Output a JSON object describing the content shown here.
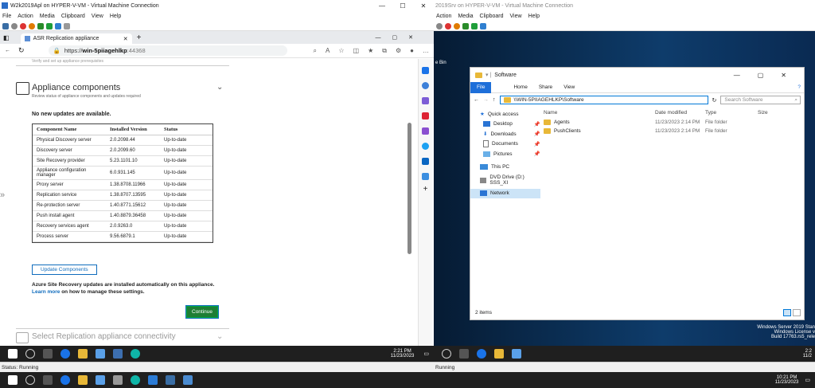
{
  "left_vm": {
    "title": "W2k2019Apl on HYPER-V-VM - Virtual Machine Connection",
    "menu": [
      "File",
      "Action",
      "Media",
      "Clipboard",
      "View",
      "Help"
    ]
  },
  "browser": {
    "tab_title": "ASR Replication appliance",
    "url_prefix": "https://",
    "url_host": "win-5piiagehlkp",
    "url_port": ":44368",
    "note": "Verify and set up appliance prerequisites"
  },
  "appliance": {
    "section_title": "Appliance components",
    "section_sub": "Review status of appliance components and updates required",
    "no_updates": "No new updates are available.",
    "headers": [
      "Component Name",
      "Installed Version",
      "Status"
    ],
    "rows": [
      [
        "Physical Discovery server",
        "2.0.2098.44",
        "Up-to-date"
      ],
      [
        "Discovery server",
        "2.0.2099.60",
        "Up-to-date"
      ],
      [
        "Site Recovery provider",
        "5.23.1101.10",
        "Up-to-date"
      ],
      [
        "Appliance configuration manager",
        "6.0.931.145",
        "Up-to-date"
      ],
      [
        "Proxy server",
        "1.38.8708.11966",
        "Up-to-date"
      ],
      [
        "Replication service",
        "1.38.8707.13595",
        "Up-to-date"
      ],
      [
        "Re-protection server",
        "1.40.8771.15612",
        "Up-to-date"
      ],
      [
        "Push install agent",
        "1.40.8879.36458",
        "Up-to-date"
      ],
      [
        "Recovery services agent",
        "2.0.9263.0",
        "Up-to-date"
      ],
      [
        "Process server",
        "9.56.6879.1",
        "Up-to-date"
      ]
    ],
    "update_btn": "Update Components",
    "auto_note": "Azure Site Recovery updates are installed automatically on this appliance.",
    "learn_more": "Learn more",
    "learn_rest": " on how to manage these settings.",
    "continue_btn": "Continue",
    "next_section": "Select Replication appliance connectivity"
  },
  "left_taskbar": {
    "time": "2:21 PM",
    "date": "11/23/2023"
  },
  "status": "Status: Running",
  "right_vm": {
    "title": "2019Srv on HYPER-V-VM - Virtual Machine Connection",
    "menu": [
      "Action",
      "Media",
      "Clipboard",
      "View",
      "Help"
    ],
    "status": "Running"
  },
  "desktop": {
    "recycle": "e Bin",
    "watermark": [
      "Windows Server 2019 Stan",
      "Windows License v",
      "Build 17763.rs5_rele"
    ],
    "time": "2:2",
    "date": "11/2"
  },
  "explorer": {
    "title": "Software",
    "ribbon": [
      "File",
      "Home",
      "Share",
      "View"
    ],
    "path": "\\\\WIN-5PIIAGEHLKP\\Software",
    "search": "Search Software",
    "nav": [
      "Quick access",
      "Desktop",
      "Downloads",
      "Documents",
      "Pictures",
      "This PC",
      "DVD Drive (D:) SSS_XI",
      "Network"
    ],
    "columns": [
      "Name",
      "Date modified",
      "Type",
      "Size"
    ],
    "files": [
      [
        "Agents",
        "11/23/2023 2:14 PM",
        "File folder"
      ],
      [
        "PushClients",
        "11/23/2023 2:14 PM",
        "File folder"
      ]
    ],
    "count": "2 items"
  },
  "host_taskbar": {
    "time": "10:21 PM",
    "date": "11/23/2023"
  }
}
